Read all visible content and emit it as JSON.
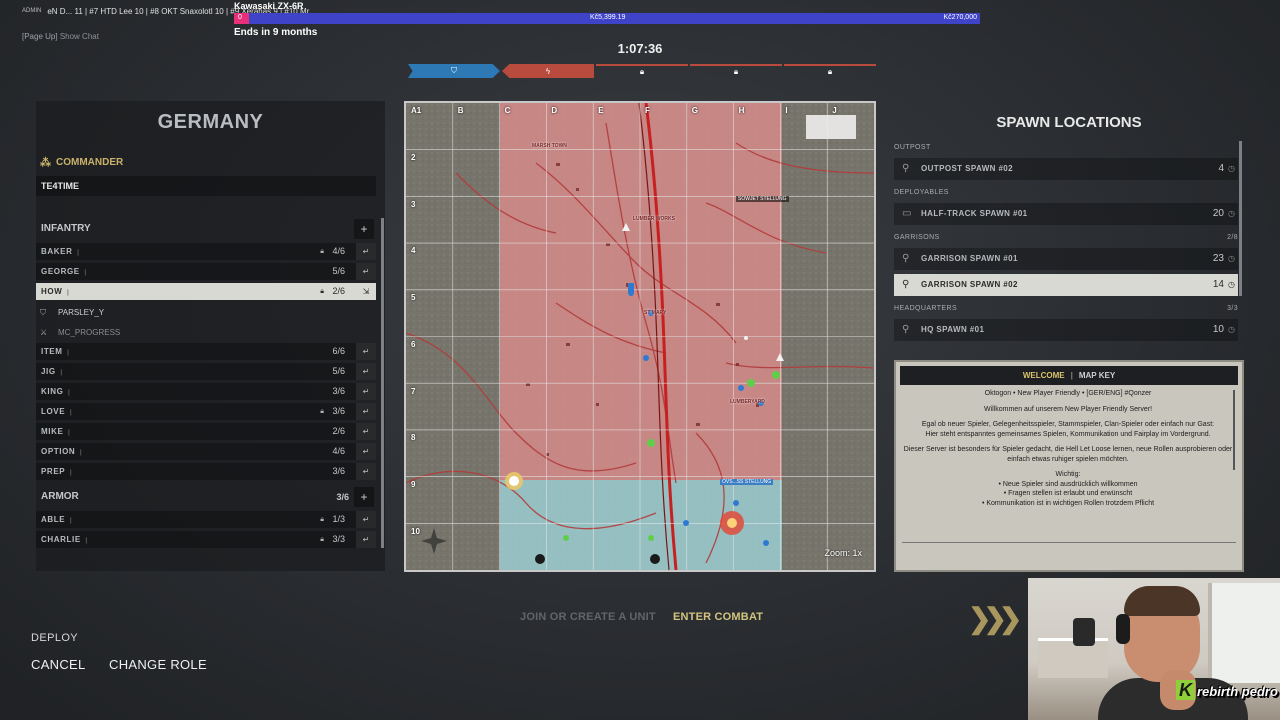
{
  "overlay": {
    "admin": "ADMIN",
    "ticker": "eN D... 11 | #7 HTD Lee 10 | #8 OKT Snaxolotl 10 | #9 Xerahas   9 | #10 Mr",
    "show_chat_key": "[Page Up]",
    "show_chat_label": "Show Chat"
  },
  "donation": {
    "title": "Kawasaki ZX-6R",
    "start": "0",
    "current": "Kč5,399.19",
    "goal": "Kč270,000",
    "progress_fraction": 0.02,
    "ends": "Ends in 9 months"
  },
  "match": {
    "timer": "1:07:36"
  },
  "left_panel": {
    "faction": "GERMANY",
    "commander_label": "COMMANDER",
    "commander_name": "TE4TIME",
    "infantry": {
      "label": "INFANTRY",
      "squads": [
        {
          "name": "BAKER",
          "count": "4/6",
          "locked": true
        },
        {
          "name": "GEORGE",
          "count": "5/6",
          "locked": false
        },
        {
          "name": "HOW",
          "count": "2/6",
          "locked": true,
          "selected": true
        },
        {
          "name": "ITEM",
          "count": "6/6",
          "locked": false
        },
        {
          "name": "JIG",
          "count": "5/6",
          "locked": false
        },
        {
          "name": "KING",
          "count": "3/6",
          "locked": false
        },
        {
          "name": "LOVE",
          "count": "3/6",
          "locked": true
        },
        {
          "name": "MIKE",
          "count": "2/6",
          "locked": false
        },
        {
          "name": "OPTION",
          "count": "4/6",
          "locked": false
        },
        {
          "name": "PREP",
          "count": "3/6",
          "locked": false
        }
      ],
      "members": [
        "PARSLEY_Y",
        "MC_PROGRESS"
      ]
    },
    "armor": {
      "label": "ARMOR",
      "count": "3/6",
      "squads": [
        {
          "name": "ABLE",
          "count": "1/3",
          "locked": true
        },
        {
          "name": "CHARLIE",
          "count": "3/3",
          "locked": true
        }
      ]
    },
    "plus": "+"
  },
  "map": {
    "columns": [
      "A1",
      "B",
      "C",
      "D",
      "E",
      "F",
      "G",
      "H",
      "I",
      "J"
    ],
    "rows": [
      "2",
      "3",
      "4",
      "5",
      "6",
      "7",
      "8",
      "9",
      "10"
    ],
    "zoom": "Zoom: 1x",
    "labels": {
      "marsh_town": "MARSH TOWN",
      "lumber_works": "LUMBER WORKS",
      "soviet": "SOWJET STELLUNG",
      "st_mary": "ST MARY",
      "lumberyard": "LUMBERYARD",
      "ovs": "OVS...SS STELLUNG"
    }
  },
  "spawns": {
    "title": "SPAWN LOCATIONS",
    "categories": [
      {
        "label": "OUTPOST",
        "extra": "",
        "items": [
          {
            "name": "OUTPOST SPAWN #02",
            "count": "4",
            "icon": "outpost-icon"
          }
        ]
      },
      {
        "label": "DEPLOYABLES",
        "extra": "",
        "items": [
          {
            "name": "HALF-TRACK SPAWN #01",
            "count": "20",
            "icon": "halftrack-icon"
          }
        ]
      },
      {
        "label": "GARRISONS",
        "extra": "2/8",
        "items": [
          {
            "name": "GARRISON SPAWN #01",
            "count": "23",
            "icon": "garrison-icon"
          },
          {
            "name": "GARRISON SPAWN #02",
            "count": "14",
            "icon": "garrison-icon",
            "selected": true
          }
        ]
      },
      {
        "label": "HEADQUARTERS",
        "extra": "3/3",
        "items": [
          {
            "name": "HQ SPAWN #01",
            "count": "10",
            "icon": "hq-icon"
          }
        ]
      }
    ]
  },
  "welcome": {
    "tab_welcome": "WELCOME",
    "tab_sep": "|",
    "tab_mapkey": "MAP KEY",
    "lines": [
      "Oktogon • New Player Friendly • [GER/ENG] #Qonzer",
      "Willkommen auf unserem New Player Friendly Server!",
      "Egal ob neuer Spieler, Gelegenheitsspieler, Stammspieler, Clan-Spieler oder einfach nur Gast:",
      "Hier steht entspanntes gemeinsames Spielen, Kommunikation und Fairplay im Vordergrund.",
      "Dieser Server ist besonders für Spieler gedacht, die Hell Let Loose lernen, neue Rollen ausprobieren oder einfach etwas ruhiger spielen möchten.",
      "Wichtig:",
      "• Neue Spieler sind ausdrücklich willkommen",
      "• Fragen stellen ist erlaubt und erwünscht",
      "• Kommunikation ist in wichtigen Rollen trotzdem Pflicht"
    ]
  },
  "bottom": {
    "join_unit": "JOIN OR CREATE A UNIT",
    "enter_combat": "ENTER COMBAT",
    "deploy": "DEPLOY",
    "cancel": "CANCEL",
    "change_role": "CHANGE ROLE"
  },
  "webcam": {
    "logo_k": "K",
    "logo_text": "rebirth pedro"
  },
  "colors": {
    "allied": "#2d79b5",
    "axis": "#b84a3e",
    "accent": "#c9b26a"
  }
}
